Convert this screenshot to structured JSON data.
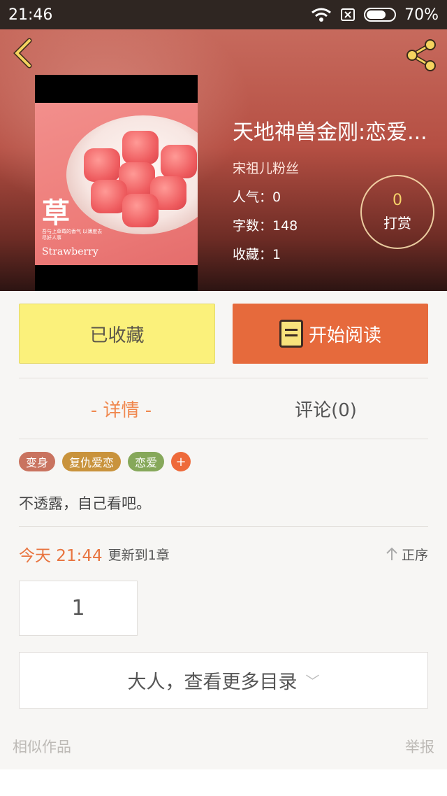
{
  "status_bar": {
    "time": "21:46",
    "battery": "70%",
    "battery_level": 0.7
  },
  "header": {
    "back_icon": "chevron-left-icon",
    "share_icon": "share-icon"
  },
  "cover": {
    "title": "草",
    "subtitle": "Strawberry",
    "small_text": "吾与上草莓的香气 以薄度去尽好人事"
  },
  "book": {
    "title": "天地神兽金刚:恋爱...",
    "author": "宋祖儿粉丝",
    "popularity": "人气：0",
    "word_count": "字数：148",
    "favorites": "收藏：1"
  },
  "reward": {
    "count": "0",
    "label": "打赏"
  },
  "actions": {
    "collect_label": "已收藏",
    "read_label": "开始阅读"
  },
  "tabs": {
    "detail": "- 详情 -",
    "comments": "评论(0)"
  },
  "tags": [
    {
      "label": "变身",
      "color": "#c9735f"
    },
    {
      "label": "复仇爱恋",
      "color": "#c9933c"
    },
    {
      "label": "恋爱",
      "color": "#86a85a"
    }
  ],
  "tag_add": "+",
  "description": "不透露，自己看吧。",
  "update": {
    "date": "今天 21:44",
    "text": "更新到1章",
    "sort_label": "正序"
  },
  "chapters": {
    "first": "1",
    "more_label": "大人，查看更多目录"
  },
  "footer": {
    "similar": "相似作品",
    "report": "举报"
  }
}
